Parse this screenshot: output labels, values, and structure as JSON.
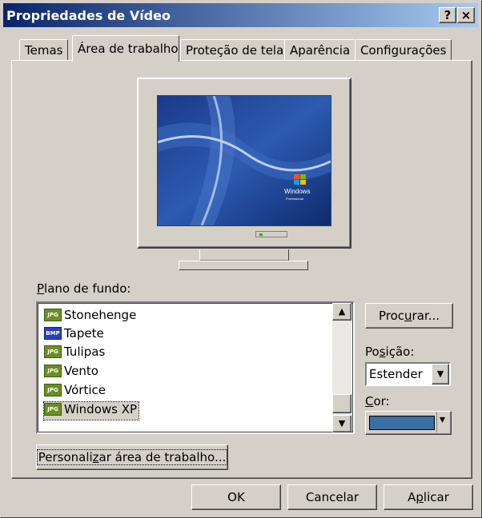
{
  "window": {
    "title": "Propriedades de Vídeo",
    "help_button": "?",
    "close_button": "×"
  },
  "tabs": [
    {
      "label": "Temas",
      "active": false
    },
    {
      "label": "Área de trabalho",
      "active": true
    },
    {
      "label": "Proteção de tela",
      "active": false
    },
    {
      "label": "Aparência",
      "active": false
    },
    {
      "label": "Configurações",
      "active": false
    }
  ],
  "preview": {
    "logo_text": "Windows",
    "logo_sub": "Professional"
  },
  "background": {
    "label_pre": "",
    "label_mnemonic": "P",
    "label_post": "lano de fundo:",
    "items": [
      {
        "name": "Stonehenge",
        "icon": "JPG",
        "selected": false
      },
      {
        "name": "Tapete",
        "icon": "BMP",
        "selected": false
      },
      {
        "name": "Tulipas",
        "icon": "JPG",
        "selected": false
      },
      {
        "name": "Vento",
        "icon": "JPG",
        "selected": false
      },
      {
        "name": "Vórtice",
        "icon": "JPG",
        "selected": false
      },
      {
        "name": "Windows XP",
        "icon": "JPG",
        "selected": true
      }
    ],
    "scroll_up": "▲",
    "scroll_down": "▼"
  },
  "browse": {
    "pre": "Proc",
    "mnemonic": "u",
    "post": "rar..."
  },
  "position": {
    "label_pre": "Po",
    "label_mnemonic": "s",
    "label_post": "ição:",
    "value": "Estender",
    "arrow": "▼"
  },
  "color": {
    "label_mnemonic": "C",
    "label_post": "or:",
    "value_hex": "#3a6ea5",
    "arrow": "▾"
  },
  "customize": {
    "pre": "Personali",
    "mnemonic": "z",
    "post": "ar área de trabalho..."
  },
  "footer": {
    "ok": "OK",
    "cancel": "Cancelar",
    "apply_pre": "A",
    "apply_mnemonic": "p",
    "apply_post": "licar"
  }
}
